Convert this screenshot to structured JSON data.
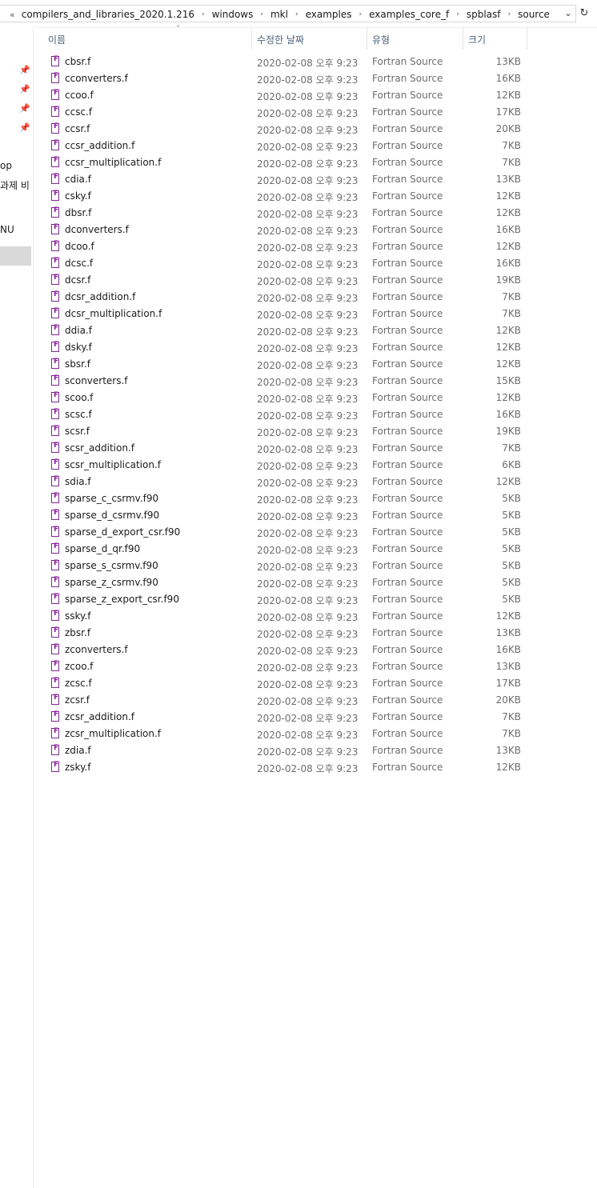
{
  "address_bar": {
    "overflow": "«",
    "crumbs": [
      "compilers_and_libraries_2020.1.216",
      "windows",
      "mkl",
      "examples",
      "examples_core_f",
      "spblasf",
      "source"
    ],
    "separator": "›",
    "dropdown": "⌄",
    "refresh": "↻"
  },
  "nav_pane": {
    "pins": [
      "📌",
      "📌",
      "📌",
      "📌"
    ],
    "labels": [
      "op",
      "과제 비",
      "NU"
    ]
  },
  "columns": {
    "name": "이름",
    "date": "수정한 날짜",
    "type": "유형",
    "size": "크기",
    "sort_indicator": "˄"
  },
  "files": [
    {
      "name": "cbsr.f",
      "date": "2020-02-08 오후 9:23",
      "type": "Fortran Source",
      "size": "13KB"
    },
    {
      "name": "cconverters.f",
      "date": "2020-02-08 오후 9:23",
      "type": "Fortran Source",
      "size": "16KB"
    },
    {
      "name": "ccoo.f",
      "date": "2020-02-08 오후 9:23",
      "type": "Fortran Source",
      "size": "12KB"
    },
    {
      "name": "ccsc.f",
      "date": "2020-02-08 오후 9:23",
      "type": "Fortran Source",
      "size": "17KB"
    },
    {
      "name": "ccsr.f",
      "date": "2020-02-08 오후 9:23",
      "type": "Fortran Source",
      "size": "20KB"
    },
    {
      "name": "ccsr_addition.f",
      "date": "2020-02-08 오후 9:23",
      "type": "Fortran Source",
      "size": "7KB"
    },
    {
      "name": "ccsr_multiplication.f",
      "date": "2020-02-08 오후 9:23",
      "type": "Fortran Source",
      "size": "7KB"
    },
    {
      "name": "cdia.f",
      "date": "2020-02-08 오후 9:23",
      "type": "Fortran Source",
      "size": "13KB"
    },
    {
      "name": "csky.f",
      "date": "2020-02-08 오후 9:23",
      "type": "Fortran Source",
      "size": "12KB"
    },
    {
      "name": "dbsr.f",
      "date": "2020-02-08 오후 9:23",
      "type": "Fortran Source",
      "size": "12KB"
    },
    {
      "name": "dconverters.f",
      "date": "2020-02-08 오후 9:23",
      "type": "Fortran Source",
      "size": "16KB"
    },
    {
      "name": "dcoo.f",
      "date": "2020-02-08 오후 9:23",
      "type": "Fortran Source",
      "size": "12KB"
    },
    {
      "name": "dcsc.f",
      "date": "2020-02-08 오후 9:23",
      "type": "Fortran Source",
      "size": "16KB"
    },
    {
      "name": "dcsr.f",
      "date": "2020-02-08 오후 9:23",
      "type": "Fortran Source",
      "size": "19KB"
    },
    {
      "name": "dcsr_addition.f",
      "date": "2020-02-08 오후 9:23",
      "type": "Fortran Source",
      "size": "7KB"
    },
    {
      "name": "dcsr_multiplication.f",
      "date": "2020-02-08 오후 9:23",
      "type": "Fortran Source",
      "size": "7KB"
    },
    {
      "name": "ddia.f",
      "date": "2020-02-08 오후 9:23",
      "type": "Fortran Source",
      "size": "12KB"
    },
    {
      "name": "dsky.f",
      "date": "2020-02-08 오후 9:23",
      "type": "Fortran Source",
      "size": "12KB"
    },
    {
      "name": "sbsr.f",
      "date": "2020-02-08 오후 9:23",
      "type": "Fortran Source",
      "size": "12KB"
    },
    {
      "name": "sconverters.f",
      "date": "2020-02-08 오후 9:23",
      "type": "Fortran Source",
      "size": "15KB"
    },
    {
      "name": "scoo.f",
      "date": "2020-02-08 오후 9:23",
      "type": "Fortran Source",
      "size": "12KB"
    },
    {
      "name": "scsc.f",
      "date": "2020-02-08 오후 9:23",
      "type": "Fortran Source",
      "size": "16KB"
    },
    {
      "name": "scsr.f",
      "date": "2020-02-08 오후 9:23",
      "type": "Fortran Source",
      "size": "19KB"
    },
    {
      "name": "scsr_addition.f",
      "date": "2020-02-08 오후 9:23",
      "type": "Fortran Source",
      "size": "7KB"
    },
    {
      "name": "scsr_multiplication.f",
      "date": "2020-02-08 오후 9:23",
      "type": "Fortran Source",
      "size": "6KB"
    },
    {
      "name": "sdia.f",
      "date": "2020-02-08 오후 9:23",
      "type": "Fortran Source",
      "size": "12KB"
    },
    {
      "name": "sparse_c_csrmv.f90",
      "date": "2020-02-08 오후 9:23",
      "type": "Fortran Source",
      "size": "5KB"
    },
    {
      "name": "sparse_d_csrmv.f90",
      "date": "2020-02-08 오후 9:23",
      "type": "Fortran Source",
      "size": "5KB"
    },
    {
      "name": "sparse_d_export_csr.f90",
      "date": "2020-02-08 오후 9:23",
      "type": "Fortran Source",
      "size": "5KB"
    },
    {
      "name": "sparse_d_qr.f90",
      "date": "2020-02-08 오후 9:23",
      "type": "Fortran Source",
      "size": "5KB"
    },
    {
      "name": "sparse_s_csrmv.f90",
      "date": "2020-02-08 오후 9:23",
      "type": "Fortran Source",
      "size": "5KB"
    },
    {
      "name": "sparse_z_csrmv.f90",
      "date": "2020-02-08 오후 9:23",
      "type": "Fortran Source",
      "size": "5KB"
    },
    {
      "name": "sparse_z_export_csr.f90",
      "date": "2020-02-08 오후 9:23",
      "type": "Fortran Source",
      "size": "5KB"
    },
    {
      "name": "ssky.f",
      "date": "2020-02-08 오후 9:23",
      "type": "Fortran Source",
      "size": "12KB"
    },
    {
      "name": "zbsr.f",
      "date": "2020-02-08 오후 9:23",
      "type": "Fortran Source",
      "size": "13KB"
    },
    {
      "name": "zconverters.f",
      "date": "2020-02-08 오후 9:23",
      "type": "Fortran Source",
      "size": "16KB"
    },
    {
      "name": "zcoo.f",
      "date": "2020-02-08 오후 9:23",
      "type": "Fortran Source",
      "size": "13KB"
    },
    {
      "name": "zcsc.f",
      "date": "2020-02-08 오후 9:23",
      "type": "Fortran Source",
      "size": "17KB"
    },
    {
      "name": "zcsr.f",
      "date": "2020-02-08 오후 9:23",
      "type": "Fortran Source",
      "size": "20KB"
    },
    {
      "name": "zcsr_addition.f",
      "date": "2020-02-08 오후 9:23",
      "type": "Fortran Source",
      "size": "7KB"
    },
    {
      "name": "zcsr_multiplication.f",
      "date": "2020-02-08 오후 9:23",
      "type": "Fortran Source",
      "size": "7KB"
    },
    {
      "name": "zdia.f",
      "date": "2020-02-08 오후 9:23",
      "type": "Fortran Source",
      "size": "13KB"
    },
    {
      "name": "zsky.f",
      "date": "2020-02-08 오후 9:23",
      "type": "Fortran Source",
      "size": "12KB"
    }
  ],
  "icon_names": {
    "file": "fortran-file-icon",
    "pin": "pin-icon",
    "folder": "folder-icon"
  }
}
